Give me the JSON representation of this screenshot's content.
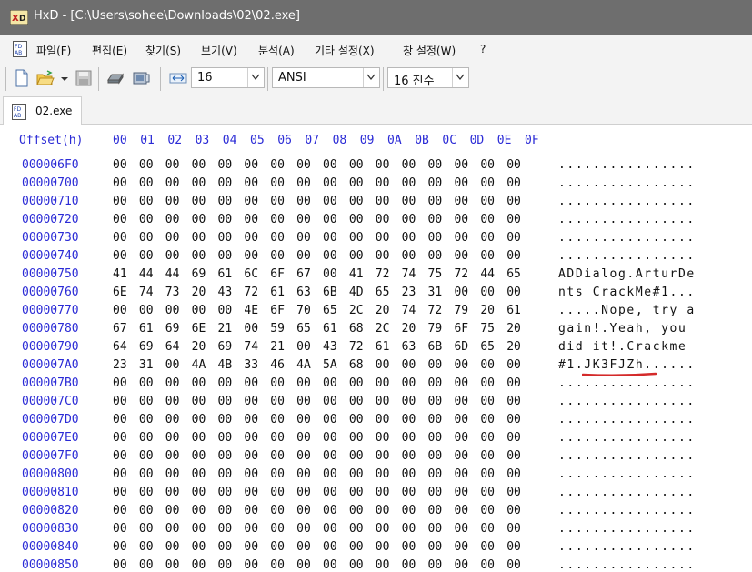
{
  "window": {
    "title": "HxD - [C:\\Users\\sohee\\Downloads\\02\\02.exe]"
  },
  "menu": [
    "파일(F)",
    "편집(E)",
    "찾기(S)",
    "보기(V)",
    "분석(A)",
    "기타 설정(X)",
    "창 설정(W)",
    "?"
  ],
  "toolbar": {
    "bytes_per_row": "16",
    "charset": "ANSI",
    "offset_base": "16 진수"
  },
  "tab": {
    "label": "02.exe"
  },
  "hex": {
    "header_offset": "Offset(h)",
    "header_cols": [
      "00",
      "01",
      "02",
      "03",
      "04",
      "05",
      "06",
      "07",
      "08",
      "09",
      "0A",
      "0B",
      "0C",
      "0D",
      "0E",
      "0F"
    ],
    "rows": [
      {
        "offset": "000006F0",
        "bytes": "00 00 00 00 00 00 00 00 00 00 00 00 00 00 00 00",
        "ascii": "................"
      },
      {
        "offset": "00000700",
        "bytes": "00 00 00 00 00 00 00 00 00 00 00 00 00 00 00 00",
        "ascii": "................"
      },
      {
        "offset": "00000710",
        "bytes": "00 00 00 00 00 00 00 00 00 00 00 00 00 00 00 00",
        "ascii": "................"
      },
      {
        "offset": "00000720",
        "bytes": "00 00 00 00 00 00 00 00 00 00 00 00 00 00 00 00",
        "ascii": "................"
      },
      {
        "offset": "00000730",
        "bytes": "00 00 00 00 00 00 00 00 00 00 00 00 00 00 00 00",
        "ascii": "................"
      },
      {
        "offset": "00000740",
        "bytes": "00 00 00 00 00 00 00 00 00 00 00 00 00 00 00 00",
        "ascii": "................"
      },
      {
        "offset": "00000750",
        "bytes": "41 44 44 69 61 6C 6F 67 00 41 72 74 75 72 44 65",
        "ascii": "ADDialog.ArturDe"
      },
      {
        "offset": "00000760",
        "bytes": "6E 74 73 20 43 72 61 63 6B 4D 65 23 31 00 00 00",
        "ascii": "nts CrackMe#1..."
      },
      {
        "offset": "00000770",
        "bytes": "00 00 00 00 00 4E 6F 70 65 2C 20 74 72 79 20 61",
        "ascii": ".....Nope, try a"
      },
      {
        "offset": "00000780",
        "bytes": "67 61 69 6E 21 00 59 65 61 68 2C 20 79 6F 75 20",
        "ascii": "gain!.Yeah, you "
      },
      {
        "offset": "00000790",
        "bytes": "64 69 64 20 69 74 21 00 43 72 61 63 6B 6D 65 20",
        "ascii": "did it!.Crackme "
      },
      {
        "offset": "000007A0",
        "bytes": "23 31 00 4A 4B 33 46 4A 5A 68 00 00 00 00 00 00",
        "ascii": "#1.JK3FJZh......"
      },
      {
        "offset": "000007B0",
        "bytes": "00 00 00 00 00 00 00 00 00 00 00 00 00 00 00 00",
        "ascii": "................"
      },
      {
        "offset": "000007C0",
        "bytes": "00 00 00 00 00 00 00 00 00 00 00 00 00 00 00 00",
        "ascii": "................"
      },
      {
        "offset": "000007D0",
        "bytes": "00 00 00 00 00 00 00 00 00 00 00 00 00 00 00 00",
        "ascii": "................"
      },
      {
        "offset": "000007E0",
        "bytes": "00 00 00 00 00 00 00 00 00 00 00 00 00 00 00 00",
        "ascii": "................"
      },
      {
        "offset": "000007F0",
        "bytes": "00 00 00 00 00 00 00 00 00 00 00 00 00 00 00 00",
        "ascii": "................"
      },
      {
        "offset": "00000800",
        "bytes": "00 00 00 00 00 00 00 00 00 00 00 00 00 00 00 00",
        "ascii": "................"
      },
      {
        "offset": "00000810",
        "bytes": "00 00 00 00 00 00 00 00 00 00 00 00 00 00 00 00",
        "ascii": "................"
      },
      {
        "offset": "00000820",
        "bytes": "00 00 00 00 00 00 00 00 00 00 00 00 00 00 00 00",
        "ascii": "................"
      },
      {
        "offset": "00000830",
        "bytes": "00 00 00 00 00 00 00 00 00 00 00 00 00 00 00 00",
        "ascii": "................"
      },
      {
        "offset": "00000840",
        "bytes": "00 00 00 00 00 00 00 00 00 00 00 00 00 00 00 00",
        "ascii": "................"
      },
      {
        "offset": "00000850",
        "bytes": "00 00 00 00 00 00 00 00 00 00 00 00 00 00 00 00",
        "ascii": "................"
      }
    ]
  },
  "annotation": {
    "color": "#d42a2a",
    "marks": "JK3FJZh"
  },
  "icons": [
    "hxd-logo-icon",
    "file-icon",
    "new-file-icon",
    "open-file-icon",
    "save-icon",
    "disk-icon",
    "ram-icon",
    "bytes-per-row-icon"
  ]
}
